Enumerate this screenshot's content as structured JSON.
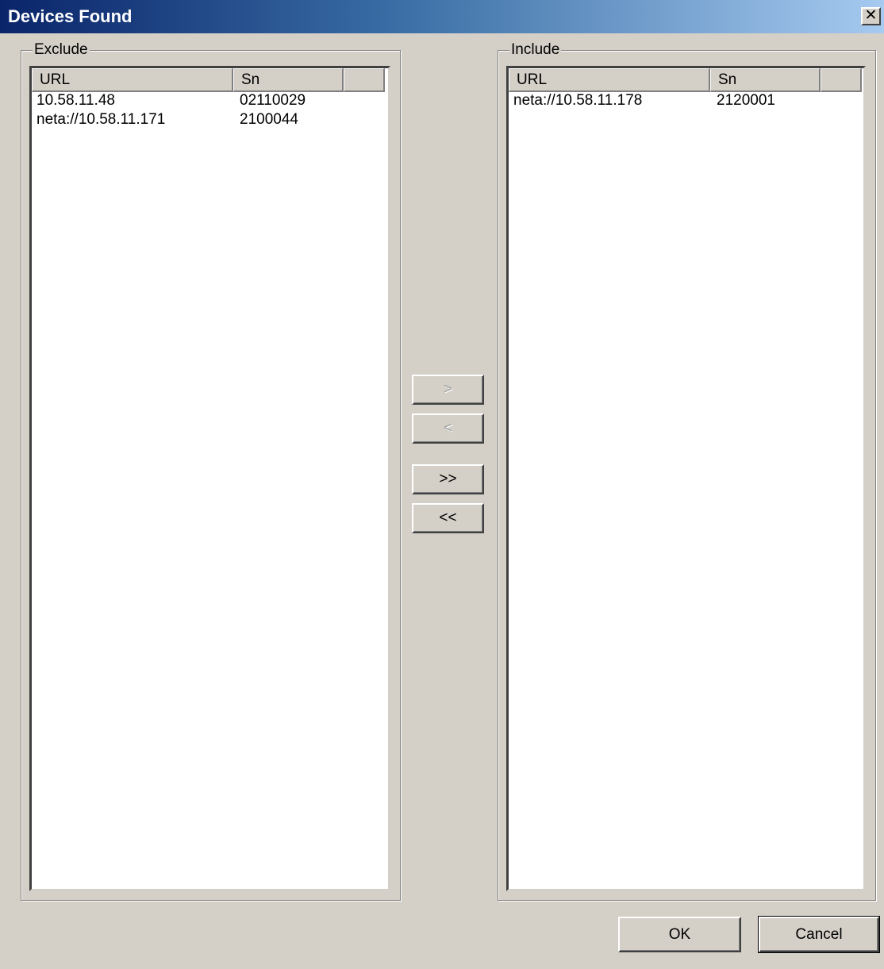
{
  "window": {
    "title": "Devices Found",
    "close_glyph": "✕"
  },
  "exclude": {
    "label": "Exclude",
    "columns": [
      "URL",
      "Sn",
      ""
    ],
    "rows": [
      {
        "url": "10.58.11.48",
        "sn": "02110029"
      },
      {
        "url": "neta://10.58.11.171",
        "sn": "2100044"
      }
    ]
  },
  "include": {
    "label": "Include",
    "columns": [
      "URL",
      "Sn",
      ""
    ],
    "rows": [
      {
        "url": "neta://10.58.11.178",
        "sn": "2120001"
      }
    ]
  },
  "transfer_buttons": {
    "move_right": ">",
    "move_left": "<",
    "move_all_right": ">>",
    "move_all_left": "<<"
  },
  "footer": {
    "ok_label": "OK",
    "cancel_label": "Cancel"
  },
  "icons": {
    "close": "close-icon"
  }
}
